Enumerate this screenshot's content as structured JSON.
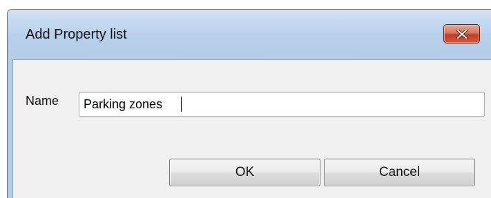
{
  "dialog": {
    "title": "Add Property list",
    "close_icon": "close-x-icon",
    "name_label": "Name",
    "name_value": "Parking zones",
    "ok_label": "OK",
    "cancel_label": "Cancel"
  },
  "colors": {
    "title_gradient": "#c4d8f0",
    "close_button": "#c13f25",
    "client_background": "#f0f0f0"
  }
}
